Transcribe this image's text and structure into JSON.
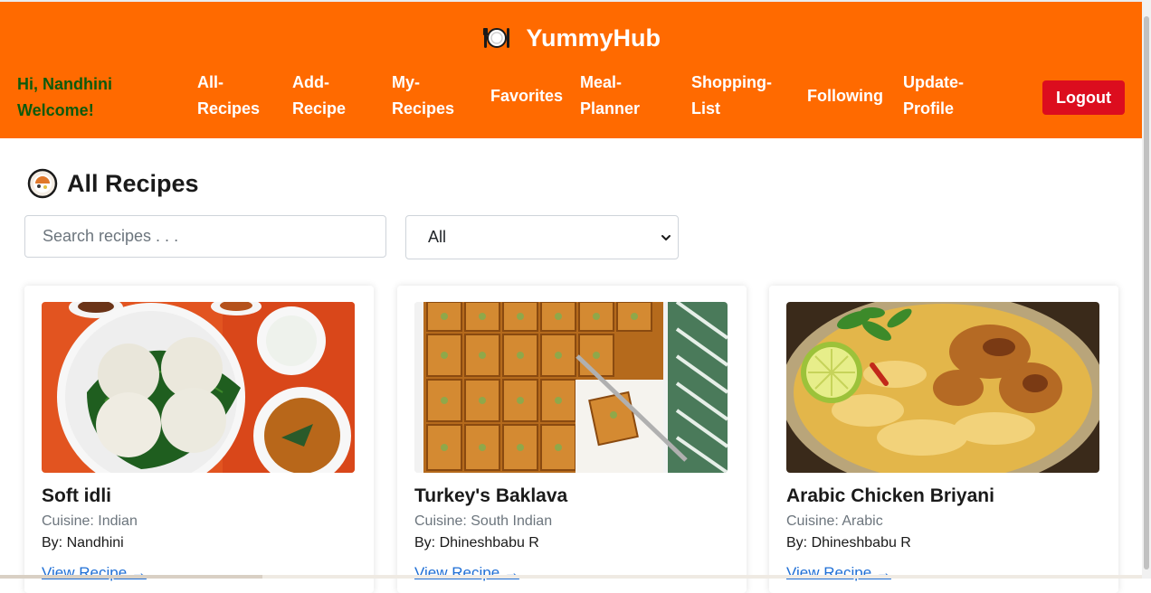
{
  "navbar": {
    "brand": "YummyHub",
    "greeting_line1": "Hi, Nandhini",
    "greeting_line2": "Welcome!",
    "links": [
      {
        "line1": "All-",
        "line2": "Recipes"
      },
      {
        "line1": "Add-",
        "line2": "Recipe"
      },
      {
        "line1": "My-",
        "line2": "Recipes"
      },
      {
        "line1": "Favorites",
        "line2": ""
      },
      {
        "line1": "Meal-",
        "line2": "Planner"
      },
      {
        "line1": "Shopping-",
        "line2": "List"
      },
      {
        "line1": "Following",
        "line2": ""
      },
      {
        "line1": "Update-",
        "line2": "Profile"
      }
    ],
    "logout_label": "Logout",
    "brand_color": "#ff6a00",
    "greeting_color": "#0c5a0c",
    "logout_color": "#dc0d1e"
  },
  "page": {
    "title": "All Recipes",
    "search_placeholder": "Search recipes . . .",
    "filter_selected": "All"
  },
  "recipes": [
    {
      "name": "Soft idli",
      "cuisine": "Cuisine: Indian",
      "author": "By: Nandhini",
      "link": "View Recipe →",
      "image": "idli-plate-photo"
    },
    {
      "name": "Turkey's Baklava",
      "cuisine": "Cuisine: South Indian",
      "author": "By: Dhineshbabu R",
      "link": "View Recipe →",
      "image": "baklava-tray-photo"
    },
    {
      "name": "Arabic Chicken Briyani",
      "cuisine": "Cuisine: Arabic",
      "author": "By: Dhineshbabu R",
      "link": "View Recipe →",
      "image": "chicken-biryani-photo"
    }
  ],
  "icons": {
    "brand": "plate-cutlery-icon",
    "title": "food-bowl-icon",
    "select": "chevron-down-icon"
  }
}
